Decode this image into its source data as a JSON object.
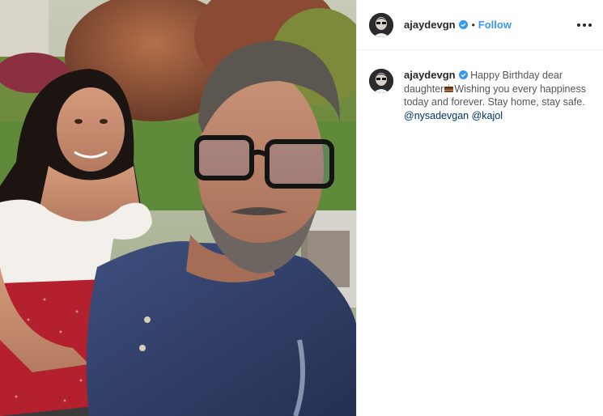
{
  "post": {
    "username": "ajaydevgn",
    "follow_label": "Follow",
    "separator": "•",
    "caption_line1": "Happy Birthday dear daughter",
    "caption_line2": "Wishing you every happiness today and forever. Stay home, stay safe.",
    "mention1": "@nysadevgan",
    "mention2": "@kajol"
  },
  "icons": {
    "verified": "verified-badge-icon",
    "more": "more-options-icon",
    "cake": "birthday-cake-emoji"
  },
  "colors": {
    "follow": "#3897f0",
    "verified": "#3897f0",
    "mention": "#003569"
  }
}
